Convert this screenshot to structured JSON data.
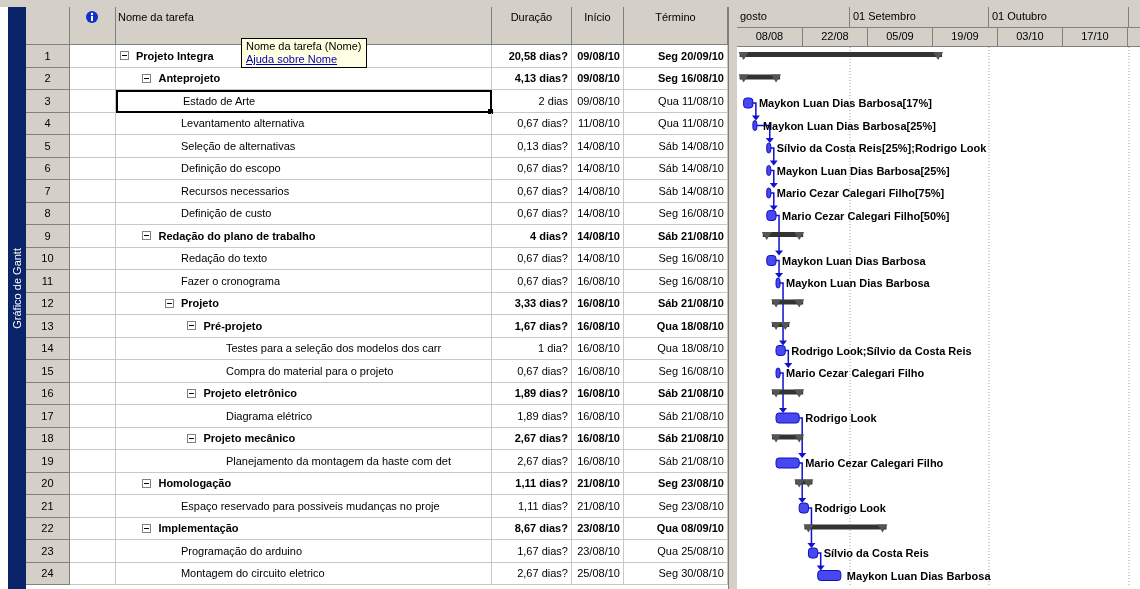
{
  "sidebar": {
    "label": "Gráfico de Gantt"
  },
  "columns": [
    {
      "label": "Nome da tarefa"
    },
    {
      "label": "Duração"
    },
    {
      "label": "Início"
    },
    {
      "label": "Término"
    }
  ],
  "tooltip": {
    "title": "Nome da tarefa (Nome)",
    "link": "Ajuda sobre Nome"
  },
  "timescale": {
    "top": [
      "gosto",
      "01 Setembro",
      "01 Outubro"
    ],
    "bottom": [
      "08/08",
      "22/08",
      "05/09",
      "19/09",
      "03/10",
      "17/10"
    ]
  },
  "tasks": [
    {
      "number": "1",
      "name": "Projeto Integra",
      "duration": "20,58 dias?",
      "start": "09/08/10",
      "finish": "Seg 20/09/10",
      "kind": "summary",
      "expanded": true,
      "selected": false,
      "children": [
        {
          "number": "2",
          "name": "Anteprojeto",
          "duration": "4,13 dias?",
          "start": "09/08/10",
          "finish": "Seg 16/08/10",
          "kind": "summary",
          "expanded": true,
          "selected": false,
          "children": [
            {
              "number": "3",
              "name": "Estado de Arte",
              "duration": "2 dias",
              "start": "09/08/10",
              "finish": "Qua 11/08/10",
              "kind": "task",
              "selected": true,
              "resources": "Maykon Luan Dias Barbosa[17%]"
            },
            {
              "number": "4",
              "name": "Levantamento alternativa",
              "duration": "0,67 dias?",
              "start": "11/08/10",
              "finish": "Qua 11/08/10",
              "kind": "task",
              "selected": false,
              "resources": "Maykon Luan Dias Barbosa[25%]"
            },
            {
              "number": "5",
              "name": "Seleção de alternativas",
              "duration": "0,13 dias?",
              "start": "14/08/10",
              "finish": "Sáb 14/08/10",
              "kind": "task",
              "selected": false,
              "resources": "Sílvio da Costa Reis[25%];Rodrigo Look"
            },
            {
              "number": "6",
              "name": "Definição do escopo",
              "duration": "0,67 dias?",
              "start": "14/08/10",
              "finish": "Sáb 14/08/10",
              "kind": "task",
              "selected": false,
              "resources": "Maykon Luan Dias Barbosa[25%]"
            },
            {
              "number": "7",
              "name": "Recursos necessarios",
              "duration": "0,67 dias?",
              "start": "14/08/10",
              "finish": "Sáb 14/08/10",
              "kind": "task",
              "selected": false,
              "resources": "Mario Cezar Calegari Filho[75%]"
            },
            {
              "number": "8",
              "name": "Definição de custo",
              "duration": "0,67 dias?",
              "start": "14/08/10",
              "finish": "Seg 16/08/10",
              "kind": "task",
              "selected": false,
              "resources": "Mario Cezar Calegari Filho[50%]"
            }
          ]
        },
        {
          "number": "9",
          "name": "Redação do plano de trabalho",
          "duration": "4 dias?",
          "start": "14/08/10",
          "finish": "Sáb 21/08/10",
          "kind": "summary",
          "expanded": true,
          "selected": false,
          "children": [
            {
              "number": "10",
              "name": "Redação do texto",
              "duration": "0,67 dias?",
              "start": "14/08/10",
              "finish": "Seg 16/08/10",
              "kind": "task",
              "selected": false,
              "resources": "Maykon Luan Dias Barbosa"
            },
            {
              "number": "11",
              "name": "Fazer o cronograma",
              "duration": "0,67 dias?",
              "start": "16/08/10",
              "finish": "Seg 16/08/10",
              "kind": "task",
              "selected": false,
              "resources": "Maykon Luan Dias Barbosa"
            },
            {
              "number": "12",
              "name": "Projeto",
              "duration": "3,33 dias?",
              "start": "16/08/10",
              "finish": "Sáb 21/08/10",
              "kind": "summary",
              "expanded": true,
              "selected": false,
              "children": [
                {
                  "number": "13",
                  "name": "Pré-projeto",
                  "duration": "1,67 dias?",
                  "start": "16/08/10",
                  "finish": "Qua 18/08/10",
                  "kind": "summary",
                  "expanded": true,
                  "selected": false,
                  "children": [
                    {
                      "number": "14",
                      "name": "Testes para a seleção dos modelos dos carr",
                      "duration": "1 dia?",
                      "start": "16/08/10",
                      "finish": "Qua 18/08/10",
                      "kind": "task",
                      "selected": false,
                      "resources": "Rodrigo Look;Sílvio da Costa Reis"
                    },
                    {
                      "number": "15",
                      "name": "Compra do material para o projeto",
                      "duration": "0,67 dias?",
                      "start": "16/08/10",
                      "finish": "Seg 16/08/10",
                      "kind": "task",
                      "selected": false,
                      "resources": "Mario Cezar Calegari Filho"
                    }
                  ]
                },
                {
                  "number": "16",
                  "name": "Projeto eletrônico",
                  "duration": "1,89 dias?",
                  "start": "16/08/10",
                  "finish": "Sáb 21/08/10",
                  "kind": "summary",
                  "expanded": true,
                  "selected": false,
                  "children": [
                    {
                      "number": "17",
                      "name": "Diagrama elétrico",
                      "duration": "1,89 dias?",
                      "start": "16/08/10",
                      "finish": "Sáb 21/08/10",
                      "kind": "task",
                      "selected": false,
                      "resources": "Rodrigo Look"
                    }
                  ]
                },
                {
                  "number": "18",
                  "name": "Projeto mecânico",
                  "duration": "2,67 dias?",
                  "start": "16/08/10",
                  "finish": "Sáb 21/08/10",
                  "kind": "summary",
                  "expanded": true,
                  "selected": false,
                  "children": [
                    {
                      "number": "19",
                      "name": "Planejamento da montagem da haste com det",
                      "duration": "2,67 dias?",
                      "start": "16/08/10",
                      "finish": "Sáb 21/08/10",
                      "kind": "task",
                      "selected": false,
                      "resources": "Mario Cezar Calegari Filho"
                    }
                  ]
                }
              ]
            }
          ]
        },
        {
          "number": "20",
          "name": "Homologação",
          "duration": "1,11 dias?",
          "start": "21/08/10",
          "finish": "Seg 23/08/10",
          "kind": "summary",
          "expanded": true,
          "selected": false,
          "children": [
            {
              "number": "21",
              "name": "Espaço reservado para possiveis mudanças no proje",
              "duration": "1,11 dias?",
              "start": "21/08/10",
              "finish": "Seg 23/08/10",
              "kind": "task",
              "selected": false,
              "resources": "Rodrigo Look"
            }
          ]
        },
        {
          "number": "22",
          "name": "Implementação",
          "duration": "8,67 dias?",
          "start": "23/08/10",
          "finish": "Qua 08/09/10",
          "kind": "summary",
          "expanded": true,
          "selected": false,
          "children": [
            {
              "number": "23",
              "name": "Programação do arduino",
              "duration": "1,67 dias?",
              "start": "23/08/10",
              "finish": "Qua 25/08/10",
              "kind": "task",
              "selected": false,
              "resources": "Sílvio da Costa Reis"
            },
            {
              "number": "24",
              "name": "Montagem do circuito eletrico",
              "duration": "2,67 dias?",
              "start": "25/08/10",
              "finish": "Seg 30/08/10",
              "kind": "task",
              "selected": false,
              "resources": "Maykon Luan Dias Barbosa"
            }
          ]
        }
      ]
    }
  ]
}
